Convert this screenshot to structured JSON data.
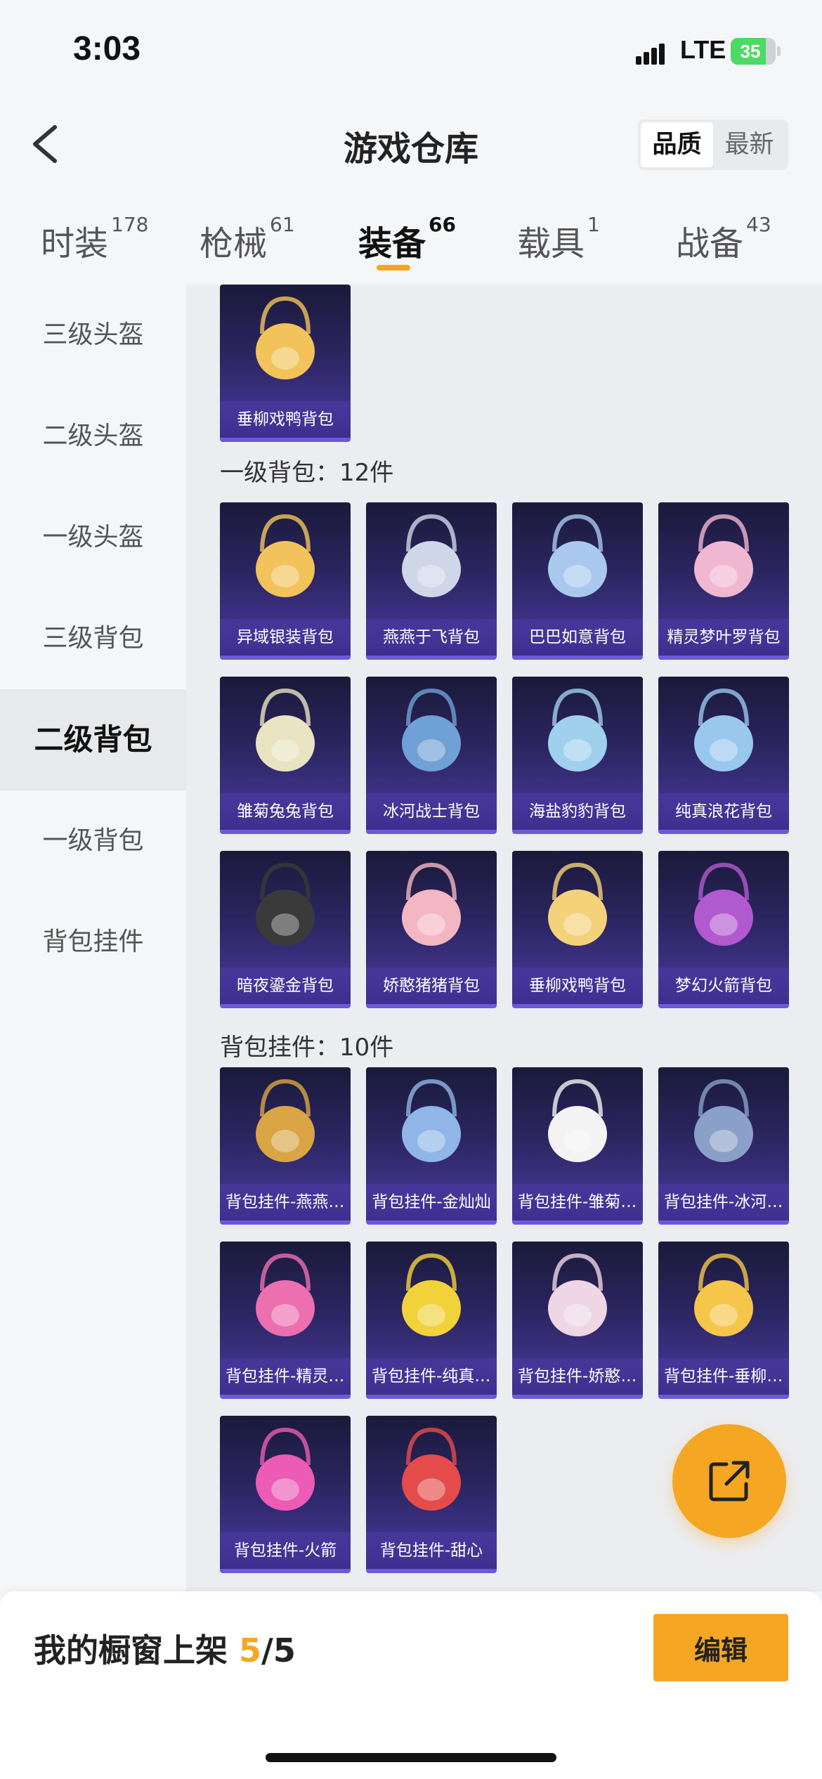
{
  "status": {
    "time": "3:03",
    "network": "LTE",
    "battery": "35"
  },
  "header": {
    "title": "游戏仓库",
    "sort_options": [
      "品质",
      "最新"
    ],
    "sort_selected": "品质"
  },
  "tabs": [
    {
      "label": "时装",
      "count": "178"
    },
    {
      "label": "枪械",
      "count": "61"
    },
    {
      "label": "装备",
      "count": "66"
    },
    {
      "label": "载具",
      "count": "1"
    },
    {
      "label": "战备",
      "count": "43"
    }
  ],
  "active_tab": "装备",
  "sidebar": {
    "items": [
      "三级头盔",
      "二级头盔",
      "一级头盔",
      "三级背包",
      "二级背包",
      "一级背包",
      "背包挂件"
    ],
    "active": "二级背包"
  },
  "sections": [
    {
      "title": "",
      "items": [
        "垂柳戏鸭背包"
      ]
    },
    {
      "title": "一级背包：12件",
      "items": [
        "异域银装背包",
        "燕燕于飞背包",
        "巴巴如意背包",
        "精灵梦叶罗背包",
        "雏菊兔兔背包",
        "冰河战士背包",
        "海盐豹豹背包",
        "纯真浪花背包",
        "暗夜鎏金背包",
        "娇憨猪猪背包",
        "垂柳戏鸭背包",
        "梦幻火箭背包"
      ]
    },
    {
      "title": "背包挂件：10件",
      "items": [
        "背包挂件-燕燕于飞",
        "背包挂件-金灿灿",
        "背包挂件-雏菊兔兔",
        "背包挂件-冰河战士",
        "背包挂件-精灵梦叶罗",
        "背包挂件-纯真浪花",
        "背包挂件-娇憨猪猪",
        "背包挂件-垂柳戏鸭",
        "背包挂件-火箭",
        "背包挂件-甜心"
      ]
    }
  ],
  "bottom": {
    "label": "我的橱窗上架",
    "current": "5",
    "total": "/5",
    "edit_label": "编辑"
  },
  "colors": {
    "accent": "#f5a623",
    "card_top": "#1a1a3a",
    "card_bottom": "#4a3aa0"
  }
}
